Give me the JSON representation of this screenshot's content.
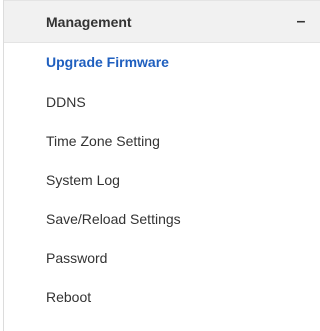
{
  "menu": {
    "title": "Management",
    "collapse_symbol": "–",
    "active_color": "#1f5fbf",
    "items": [
      {
        "label": "Upgrade Firmware",
        "active": true
      },
      {
        "label": "DDNS",
        "active": false
      },
      {
        "label": "Time Zone Setting",
        "active": false
      },
      {
        "label": "System Log",
        "active": false
      },
      {
        "label": "Save/Reload Settings",
        "active": false
      },
      {
        "label": "Password",
        "active": false
      },
      {
        "label": "Reboot",
        "active": false
      }
    ]
  }
}
